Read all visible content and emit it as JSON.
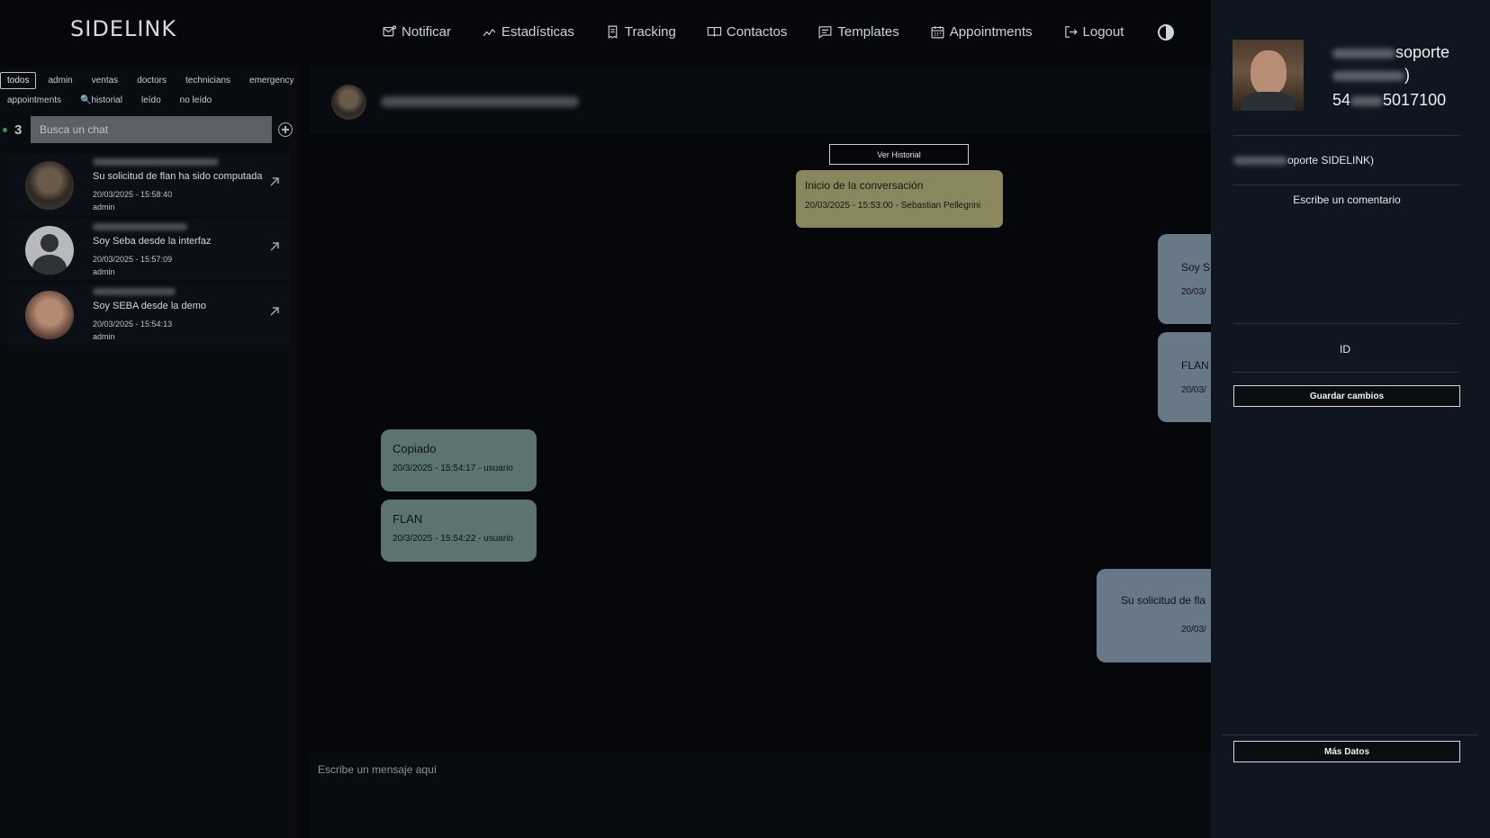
{
  "app": {
    "logo": "SIDELINK"
  },
  "nav": {
    "items": [
      {
        "label": "Notificar",
        "icon": "notify-icon"
      },
      {
        "label": "Estadísticas",
        "icon": "chart-icon"
      },
      {
        "label": "Tracking",
        "icon": "receipt-icon"
      },
      {
        "label": "Contactos",
        "icon": "book-icon"
      },
      {
        "label": "Templates",
        "icon": "message-icon"
      },
      {
        "label": "Appointments",
        "icon": "calendar-icon"
      },
      {
        "label": "Logout",
        "icon": "logout-icon"
      }
    ],
    "theme_icon": "contrast-icon"
  },
  "filters": {
    "row1": [
      "todos",
      "admin",
      "ventas",
      "doctors",
      "technicians",
      "emergency"
    ],
    "row2": [
      "appointments",
      "historial",
      "leído",
      "no leído"
    ],
    "active": "todos"
  },
  "search": {
    "count": "3",
    "placeholder": "Busca un chat"
  },
  "chats": [
    {
      "message": "Su solicitud de flan ha sido computada",
      "time": "20/03/2025 - 15:58:40",
      "role": "admin"
    },
    {
      "message": "Soy Seba desde la interfaz",
      "time": "20/03/2025 - 15:57:09",
      "role": "admin"
    },
    {
      "message": "Soy SEBA desde la demo",
      "time": "20/03/2025 - 15:54:13",
      "role": "admin"
    }
  ],
  "conversation": {
    "ver_historial": "Ver Historial",
    "system_message": {
      "text": "Inicio de la conversación",
      "meta": "20/03/2025 - 15:53:00 - Sebastian Pellegrini"
    },
    "incoming": [
      {
        "text": "Copiado",
        "meta": "20/3/2025 - 15:54:17 - usuario"
      },
      {
        "text": "FLAN",
        "meta": "20/3/2025 - 15:54:22 - usuario"
      }
    ],
    "outgoing": [
      {
        "text": "Soy S",
        "meta": "20/03/"
      },
      {
        "text": "FLAN",
        "meta": "20/03/"
      },
      {
        "text": "Su solicitud de fla",
        "meta": "20/03/"
      }
    ],
    "composer_placeholder": "Escribe un mensaje aquí"
  },
  "profile": {
    "line1_suffix": "soporte",
    "line2_suffix": ")",
    "phone_prefix": "54",
    "phone_suffix": "5017100",
    "team_suffix": "oporte SIDELINK)",
    "comment_placeholder": "Escribe un comentario",
    "id_label": "ID",
    "save_button": "Guardar cambios",
    "more_button": "Más Datos"
  }
}
